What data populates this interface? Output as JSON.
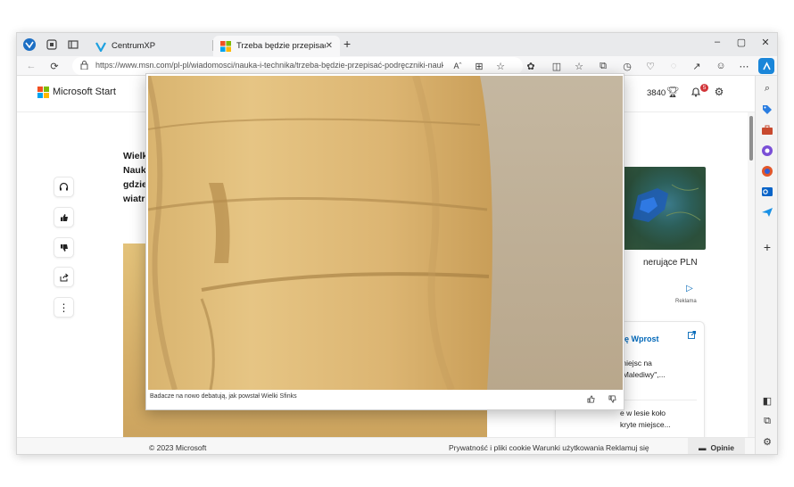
{
  "browser": {
    "tabs": [
      {
        "title": "CentrumXP",
        "active": false
      },
      {
        "title": "Trzeba będzie przepisać podręcz",
        "active": true
      }
    ],
    "new_tab_symbol": "+",
    "window_controls": [
      "–",
      "▢",
      "✕"
    ],
    "url": "https://www.msn.com/pl-pl/wiadomosci/nauka-i-technika/trzeba-będzie-przepisać-podręczniki-naukowc...",
    "reader_label": "Aˆ",
    "accent": "#0067b8"
  },
  "page": {
    "logo_text": "Microsoft Start",
    "points": "3840",
    "notification_count": "5",
    "article_title_lines": [
      "Wielk",
      "Nauk",
      "gdzie",
      "wiatr"
    ],
    "ad": {
      "text": "nerujące PLN",
      "label": "Reklama"
    },
    "related": {
      "source": "ę Wprost",
      "items": [
        [
          "miejsc na",
          " „Malediwy\",..."
        ],
        [
          "e w lesie koło",
          "kryte miejsce..."
        ]
      ]
    },
    "footer": {
      "copyright": "© 2023 Microsoft",
      "links": [
        "Prywatność i pliki cookie",
        "Warunki użytkowania",
        "Reklamuj się"
      ],
      "feedback": "Opinie"
    }
  },
  "modal": {
    "caption": "Badacze na nowo debatują, jak powstał Wielki Sfinks"
  }
}
